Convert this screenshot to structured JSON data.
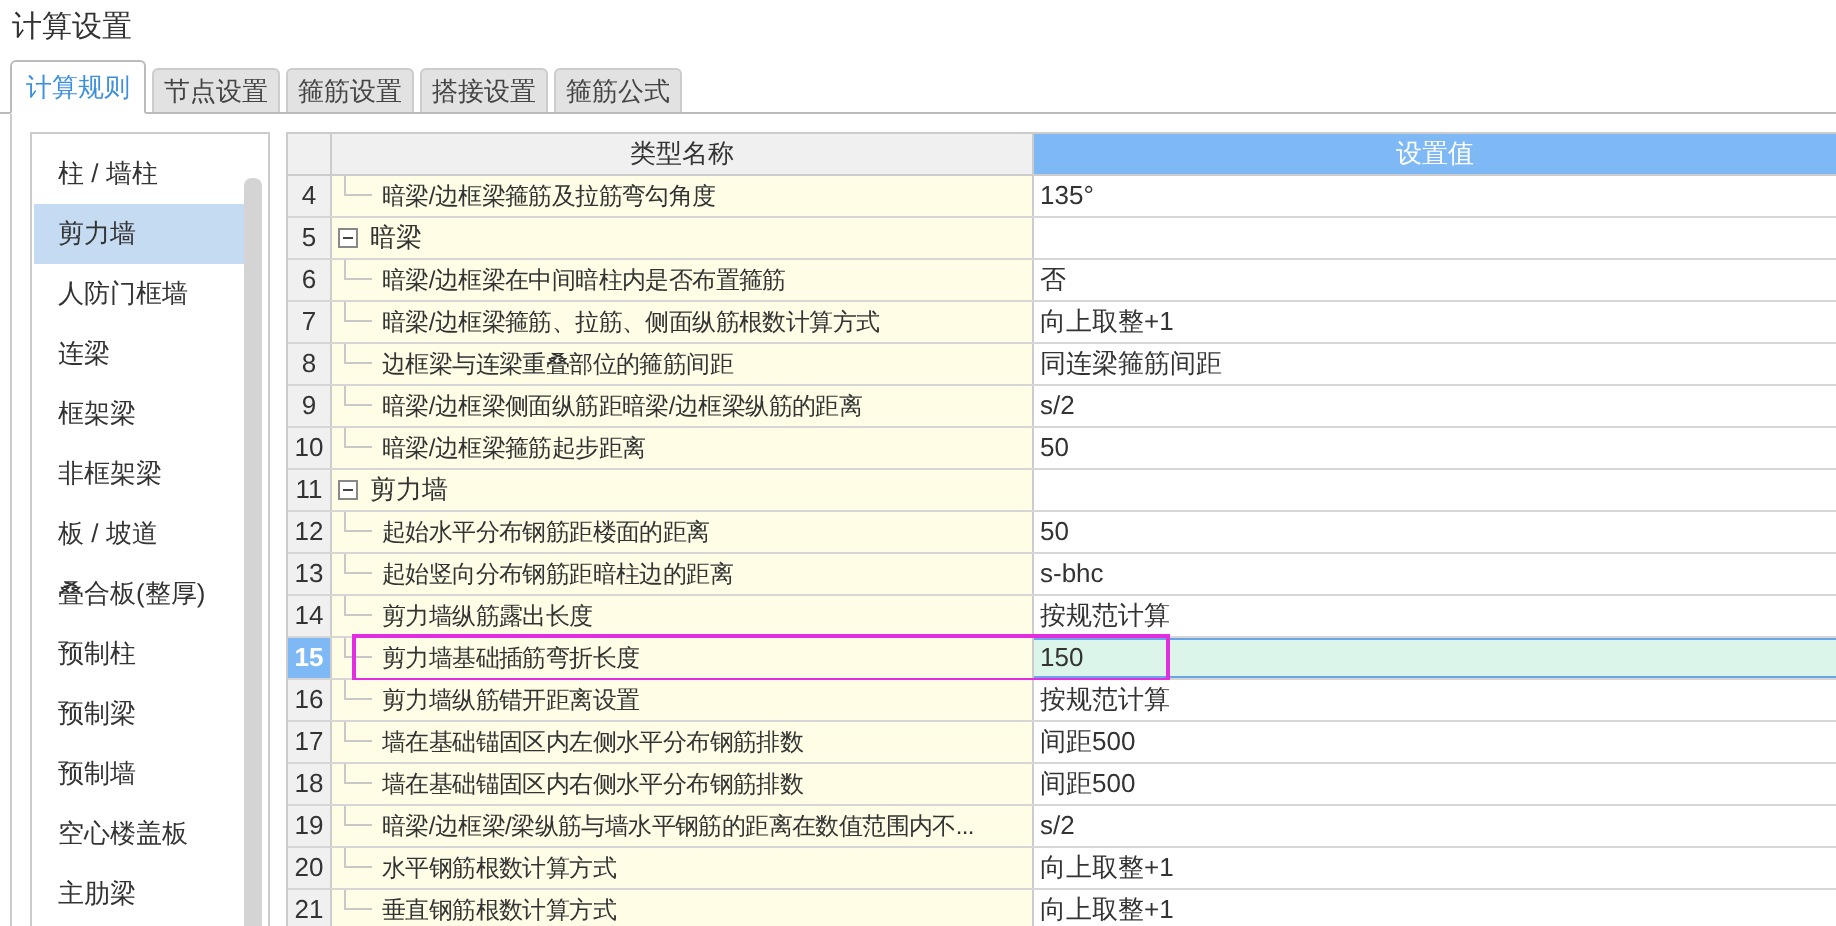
{
  "window": {
    "title": "计算设置"
  },
  "tabs": [
    {
      "label": "计算规则",
      "selected": true
    },
    {
      "label": "节点设置",
      "selected": false
    },
    {
      "label": "箍筋设置",
      "selected": false
    },
    {
      "label": "搭接设置",
      "selected": false
    },
    {
      "label": "箍筋公式",
      "selected": false
    }
  ],
  "sidebar": {
    "items": [
      {
        "label": "柱 / 墙柱",
        "selected": false
      },
      {
        "label": "剪力墙",
        "selected": true
      },
      {
        "label": "人防门框墙",
        "selected": false
      },
      {
        "label": "连梁",
        "selected": false
      },
      {
        "label": "框架梁",
        "selected": false
      },
      {
        "label": "非框架梁",
        "selected": false
      },
      {
        "label": "板 / 坡道",
        "selected": false
      },
      {
        "label": "叠合板(整厚)",
        "selected": false
      },
      {
        "label": "预制柱",
        "selected": false
      },
      {
        "label": "预制梁",
        "selected": false
      },
      {
        "label": "预制墙",
        "selected": false
      },
      {
        "label": "空心楼盖板",
        "selected": false
      },
      {
        "label": "主肋梁",
        "selected": false
      }
    ]
  },
  "table": {
    "columns": [
      "类型名称",
      "设置值"
    ],
    "rows": [
      {
        "kind": "item",
        "number": "4",
        "name": "暗梁/边框梁箍筋及拉筋弯勾角度",
        "value": "135°",
        "selected": false,
        "highlighted": false
      },
      {
        "kind": "group",
        "number": "5",
        "name": "暗梁",
        "expanded": true,
        "selected": false,
        "highlighted": false
      },
      {
        "kind": "item",
        "number": "6",
        "name": "暗梁/边框梁在中间暗柱内是否布置箍筋",
        "value": "否",
        "selected": false,
        "highlighted": false
      },
      {
        "kind": "item",
        "number": "7",
        "name": "暗梁/边框梁箍筋、拉筋、侧面纵筋根数计算方式",
        "value": "向上取整+1",
        "selected": false,
        "highlighted": false
      },
      {
        "kind": "item",
        "number": "8",
        "name": "边框梁与连梁重叠部位的箍筋间距",
        "value": "同连梁箍筋间距",
        "selected": false,
        "highlighted": false
      },
      {
        "kind": "item",
        "number": "9",
        "name": "暗梁/边框梁侧面纵筋距暗梁/边框梁纵筋的距离",
        "value": "s/2",
        "selected": false,
        "highlighted": false
      },
      {
        "kind": "item",
        "number": "10",
        "name": "暗梁/边框梁箍筋起步距离",
        "value": "50",
        "selected": false,
        "highlighted": false
      },
      {
        "kind": "group",
        "number": "11",
        "name": "剪力墙",
        "expanded": true,
        "selected": false,
        "highlighted": false
      },
      {
        "kind": "item",
        "number": "12",
        "name": "起始水平分布钢筋距楼面的距离",
        "value": "50",
        "selected": false,
        "highlighted": false
      },
      {
        "kind": "item",
        "number": "13",
        "name": "起始竖向分布钢筋距暗柱边的距离",
        "value": "s-bhc",
        "selected": false,
        "highlighted": false
      },
      {
        "kind": "item",
        "number": "14",
        "name": "剪力墙纵筋露出长度",
        "value": "按规范计算",
        "selected": false,
        "highlighted": false
      },
      {
        "kind": "item",
        "number": "15",
        "name": "剪力墙基础插筋弯折长度",
        "value": "150",
        "selected": true,
        "highlighted": true
      },
      {
        "kind": "item",
        "number": "16",
        "name": "剪力墙纵筋错开距离设置",
        "value": "按规范计算",
        "selected": false,
        "highlighted": false
      },
      {
        "kind": "item",
        "number": "17",
        "name": "墙在基础锚固区内左侧水平分布钢筋排数",
        "value": "间距500",
        "selected": false,
        "highlighted": false
      },
      {
        "kind": "item",
        "number": "18",
        "name": "墙在基础锚固区内右侧水平分布钢筋排数",
        "value": "间距500",
        "selected": false,
        "highlighted": false
      },
      {
        "kind": "item",
        "number": "19",
        "name": "暗梁/边框梁/梁纵筋与墙水平钢筋的距离在数值范围内不...",
        "value": "s/2",
        "selected": false,
        "highlighted": false
      },
      {
        "kind": "item",
        "number": "20",
        "name": "水平钢筋根数计算方式",
        "value": "向上取整+1",
        "selected": false,
        "highlighted": false
      },
      {
        "kind": "item",
        "number": "21",
        "name": "垂直钢筋根数计算方式",
        "value": "向上取整+1",
        "selected": false,
        "highlighted": false
      }
    ]
  }
}
